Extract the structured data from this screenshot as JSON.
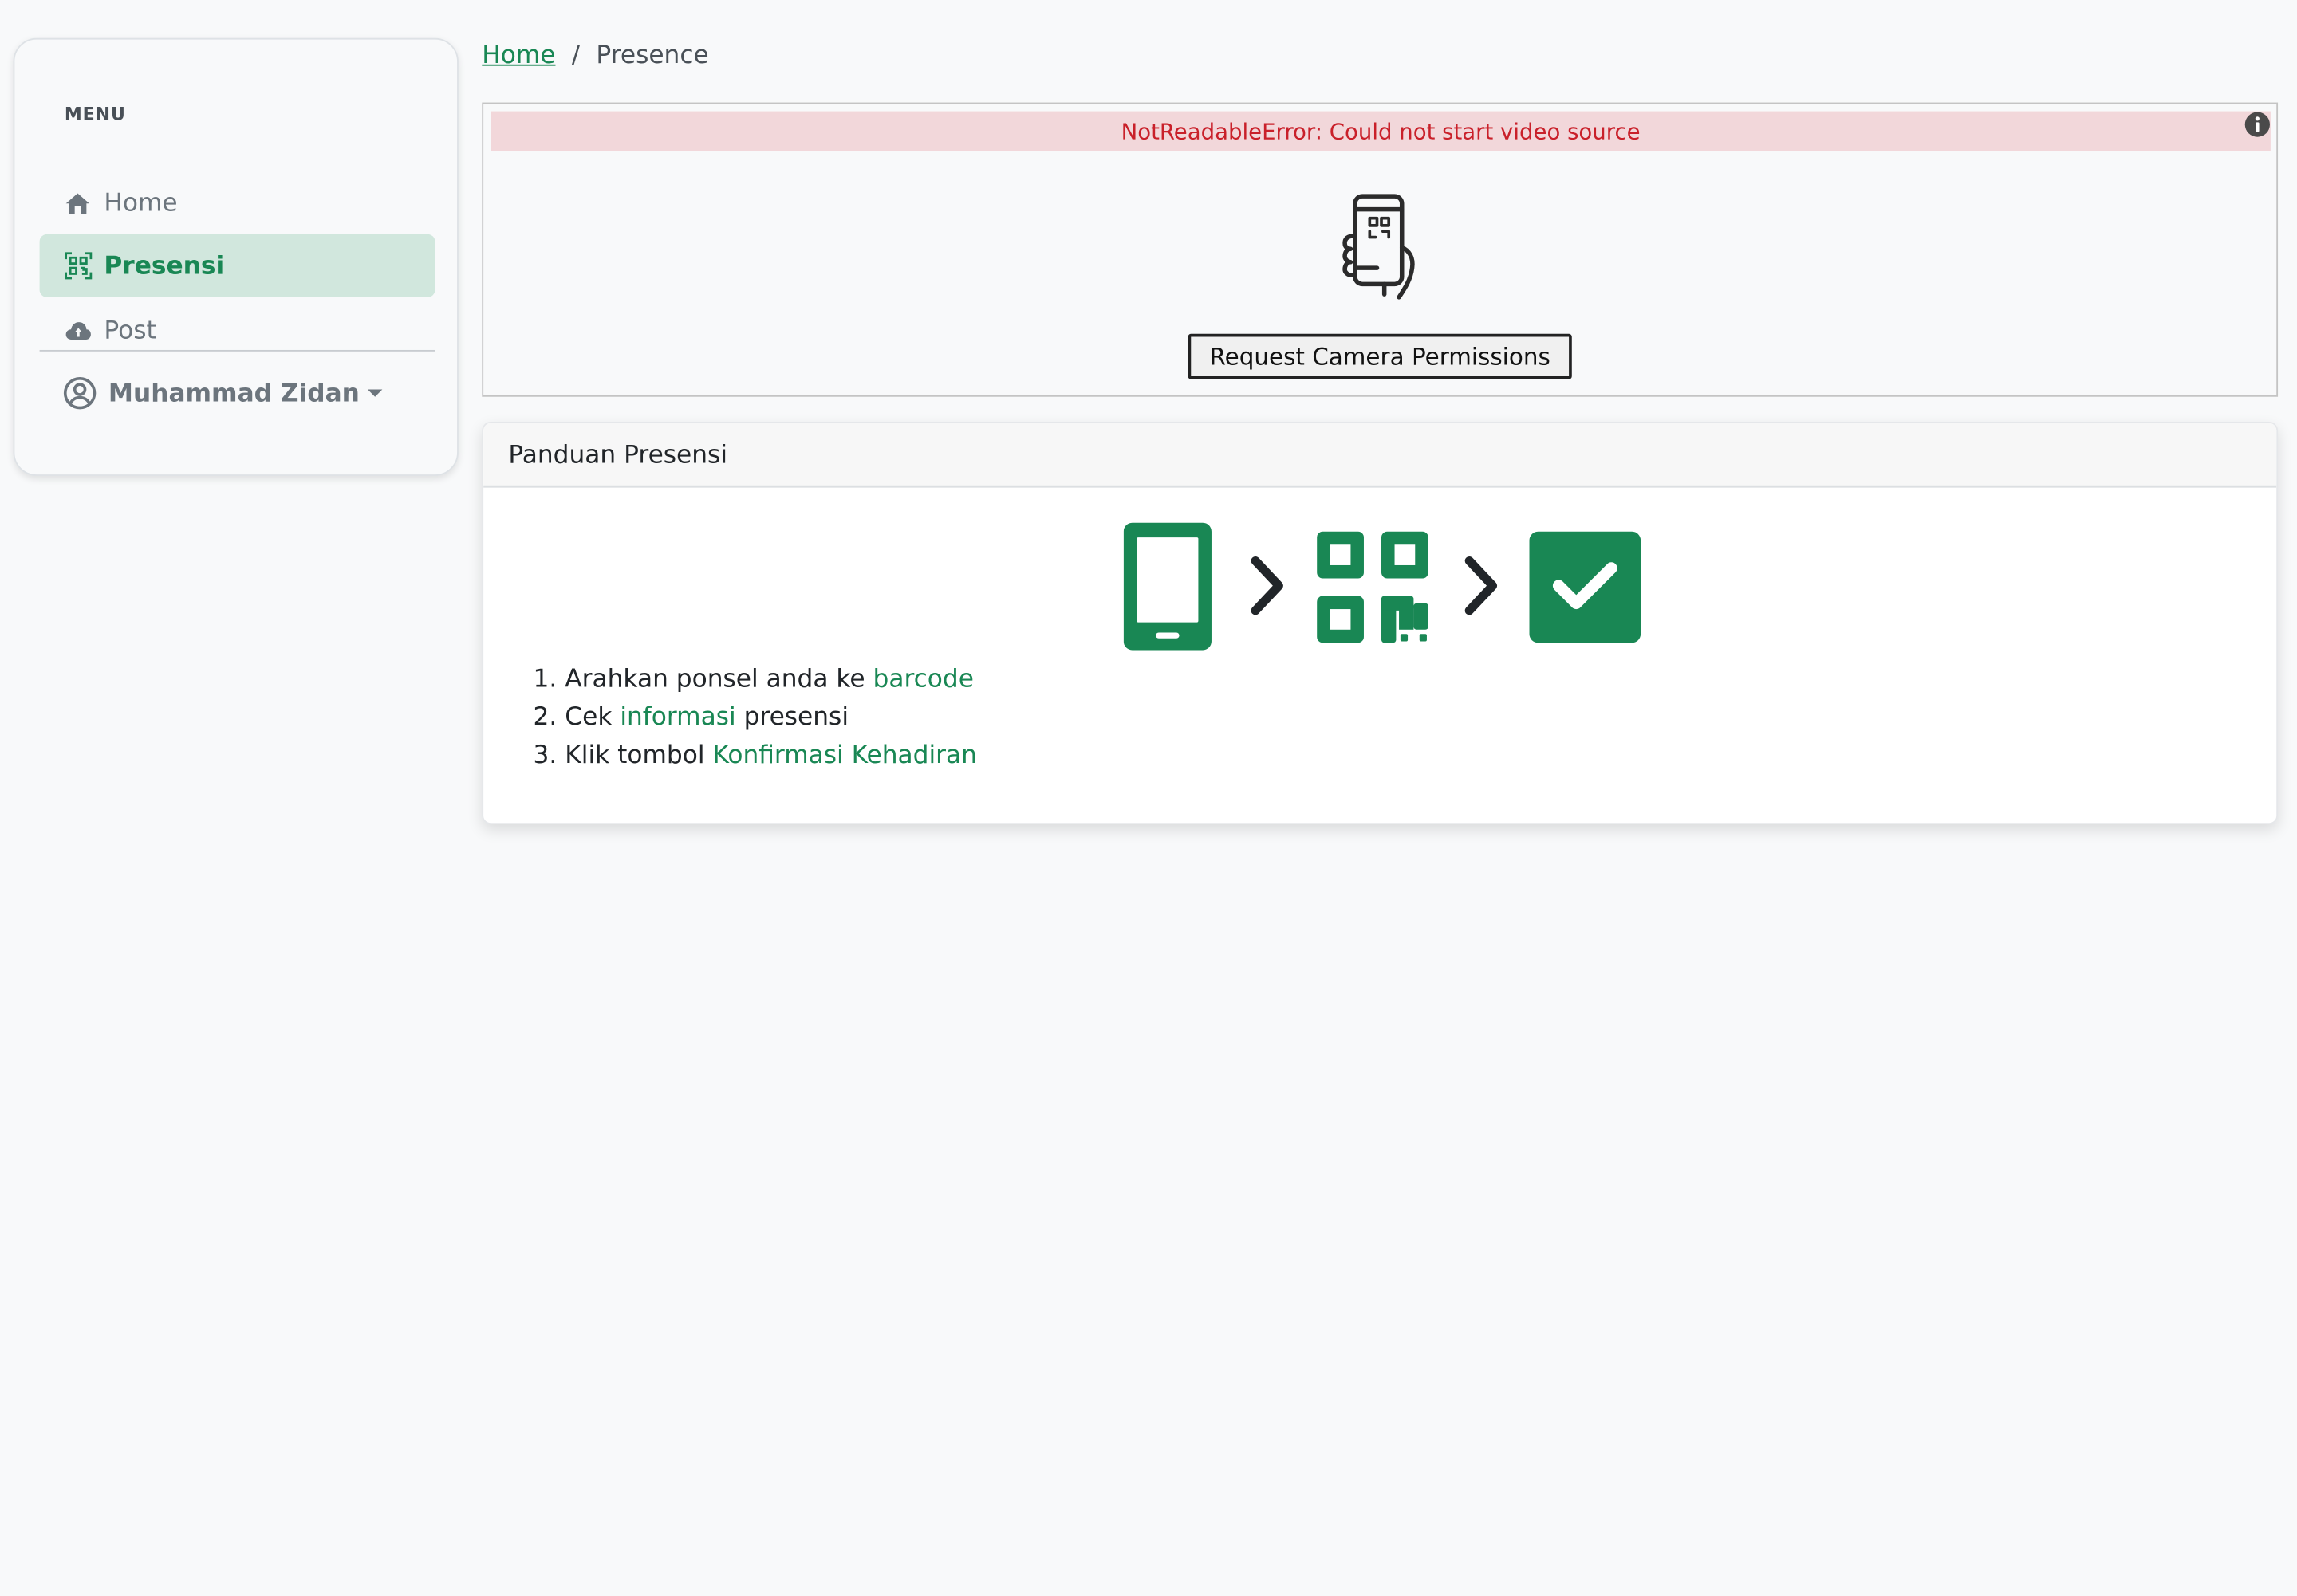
{
  "sidebar": {
    "menu_label": "MENU",
    "items": [
      {
        "label": "Home",
        "icon": "home-icon",
        "active": false
      },
      {
        "label": "Presensi",
        "icon": "qr-scan-icon",
        "active": true
      },
      {
        "label": "Post",
        "icon": "cloud-upload-icon",
        "active": false
      }
    ],
    "user": {
      "name": "Muhammad Zidan",
      "icon": "user-circle-icon"
    }
  },
  "breadcrumb": {
    "home": "Home",
    "separator": "/",
    "current": "Presence"
  },
  "scanner": {
    "error": "NotReadableError: Could not start video source",
    "permission_button": "Request Camera Permissions",
    "illustration": "phone-in-hand-icon"
  },
  "guide": {
    "title": "Panduan Presensi",
    "icons": [
      "smartphone-icon",
      "chevron-right-icon",
      "qr-code-icon",
      "chevron-right-icon",
      "check-square-icon"
    ],
    "steps": [
      {
        "num": "1.",
        "before": "Arahkan ponsel anda ke ",
        "highlight": "barcode",
        "after": ""
      },
      {
        "num": "2.",
        "before": "Cek ",
        "highlight": "informasi",
        "after": " presensi"
      },
      {
        "num": "3.",
        "before": "Klik tombol ",
        "highlight": "Konfirmasi Kehadiran",
        "after": ""
      }
    ]
  },
  "colors": {
    "primary": "#198754",
    "active_bg": "#d1e7dd",
    "error_text": "#c9202a",
    "error_bg": "#f2d7da",
    "page_bg": "#f8f9fa"
  }
}
